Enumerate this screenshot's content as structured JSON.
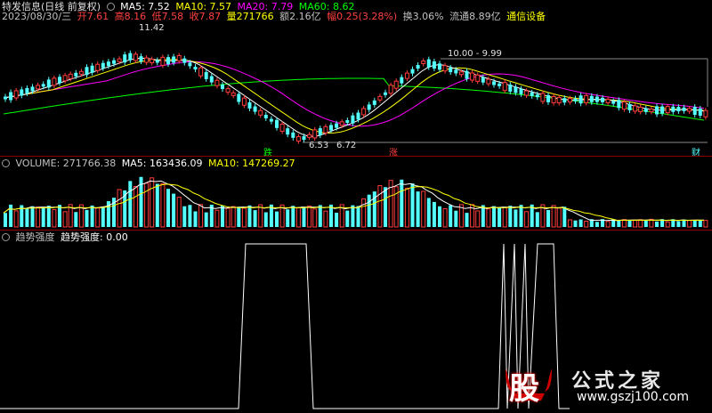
{
  "header": {
    "title": "特发信息(日线 前复权)",
    "ma5": "MA5: 7.52",
    "ma10": "MA10: 7.57",
    "ma20": "MA20: 7.79",
    "ma60": "MA60: 8.62"
  },
  "info": {
    "date": "2023/08/30/三",
    "open": "开7.61",
    "high": "高8.16",
    "low": "低7.58",
    "close": "收7.87",
    "vol": "量271766",
    "amount": "额2.16亿",
    "change": "幅0.25(3.28%)",
    "turnover": "换3.06%",
    "float": "流通8.89亿",
    "link": "通信设备"
  },
  "price_labels": {
    "high_mark": "11.42",
    "range_mark": "10.00 - 9.99",
    "low_mark_a": "6.53",
    "low_mark_b": "6.72",
    "tag_die": "跌",
    "tag_zhang": "涨",
    "tag_cai": "财"
  },
  "volume": {
    "label": "VOLUME: 271766.38",
    "ma5": "MA5: 163436.09",
    "ma10": "MA10: 147269.27"
  },
  "indicator": {
    "name": "趋势强度",
    "value_label": "趋势强度: 0.00"
  },
  "watermark": {
    "logo_char": "股",
    "text": "公式之家",
    "url": "www.gszj100.com"
  },
  "colors": {
    "up": "#ff3c3c",
    "down": "#54ffff",
    "ma5": "#ffffff",
    "ma10": "#ffff00",
    "ma20": "#ff00ff",
    "ma60": "#00ff00",
    "link": "#ffff00"
  }
}
